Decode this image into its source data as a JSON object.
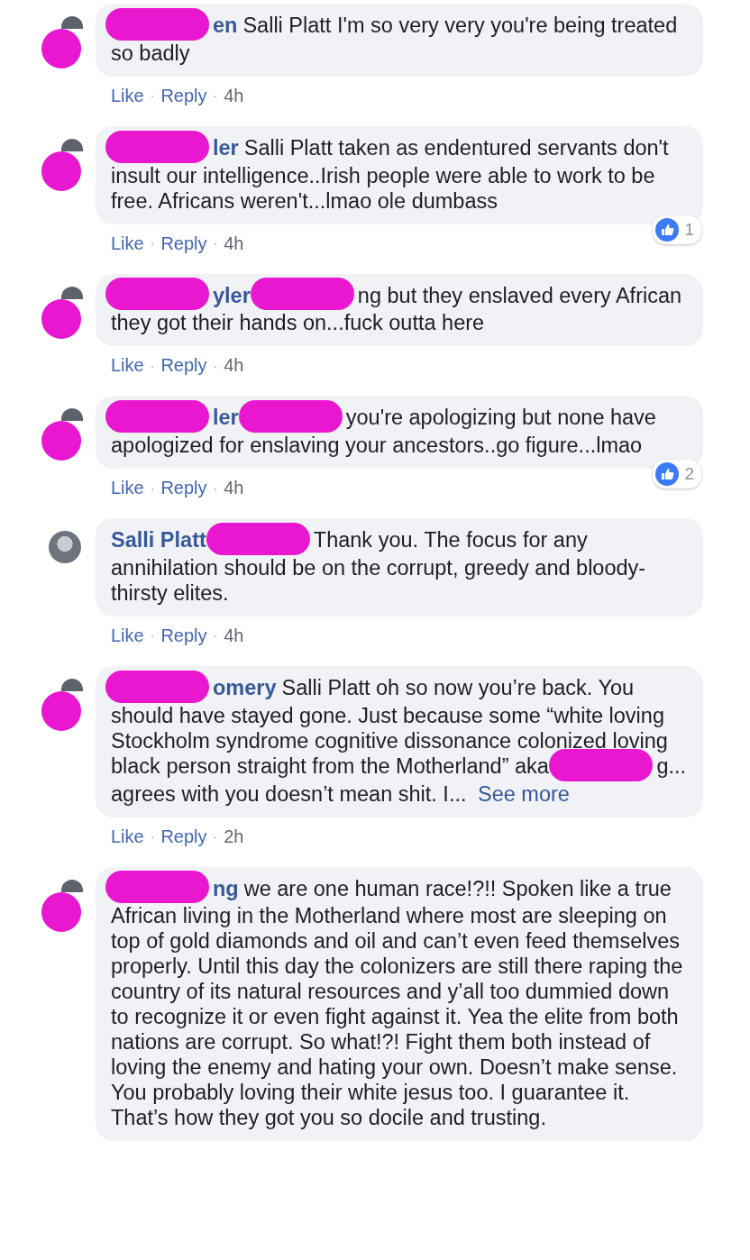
{
  "comments": [
    {
      "avatar_redacted": true,
      "segments": [
        {
          "kind": "redaction"
        },
        {
          "kind": "name",
          "text": "en"
        },
        {
          "kind": "text",
          "text": "Salli Platt I'm so very very you're being treated so badly"
        }
      ],
      "actions": [
        {
          "kind": "link",
          "text": "Like"
        },
        {
          "kind": "sep",
          "text": "·"
        },
        {
          "kind": "link",
          "text": "Reply"
        },
        {
          "kind": "sep",
          "text": "·"
        },
        {
          "kind": "time",
          "text": "4h"
        }
      ]
    },
    {
      "avatar_redacted": true,
      "segments": [
        {
          "kind": "redaction"
        },
        {
          "kind": "name",
          "text": "ler"
        },
        {
          "kind": "text",
          "text": "Salli Platt taken as endentured servants don't insult our intelligence..Irish people were able to work to be free. Africans weren't...lmao ole dumbass"
        }
      ],
      "reactions": "1",
      "actions": [
        {
          "kind": "link",
          "text": "Like"
        },
        {
          "kind": "sep",
          "text": "·"
        },
        {
          "kind": "link",
          "text": "Reply"
        },
        {
          "kind": "sep",
          "text": "·"
        },
        {
          "kind": "time",
          "text": "4h"
        }
      ]
    },
    {
      "avatar_redacted": true,
      "segments": [
        {
          "kind": "redaction"
        },
        {
          "kind": "name",
          "text": "yler"
        },
        {
          "kind": "redaction"
        },
        {
          "kind": "text",
          "text": "ng but they enslaved every African they got their hands on...fuck outta here"
        }
      ],
      "actions": [
        {
          "kind": "link",
          "text": "Like"
        },
        {
          "kind": "sep",
          "text": "·"
        },
        {
          "kind": "link",
          "text": "Reply"
        },
        {
          "kind": "sep",
          "text": "·"
        },
        {
          "kind": "time",
          "text": "4h"
        }
      ]
    },
    {
      "avatar_redacted": true,
      "segments": [
        {
          "kind": "redaction"
        },
        {
          "kind": "name",
          "text": "ler"
        },
        {
          "kind": "redaction"
        },
        {
          "kind": "text",
          "text": "you're apologizing but none have apologized for enslaving your ancestors..go figure...lmao"
        }
      ],
      "reactions": "2",
      "actions": [
        {
          "kind": "link",
          "text": "Like"
        },
        {
          "kind": "sep",
          "text": "·"
        },
        {
          "kind": "link",
          "text": "Reply"
        },
        {
          "kind": "sep",
          "text": "·"
        },
        {
          "kind": "time",
          "text": "4h"
        }
      ]
    },
    {
      "avatar_redacted": false,
      "segments": [
        {
          "kind": "name",
          "text": "Salli Platt"
        },
        {
          "kind": "redaction"
        },
        {
          "kind": "text",
          "text": "Thank you. The focus for any annihilation should be on the corrupt, greedy and bloody-thirsty elites."
        }
      ],
      "actions": [
        {
          "kind": "link",
          "text": "Like"
        },
        {
          "kind": "sep",
          "text": "·"
        },
        {
          "kind": "link",
          "text": "Reply"
        },
        {
          "kind": "sep",
          "text": "·"
        },
        {
          "kind": "time",
          "text": "4h"
        }
      ]
    },
    {
      "avatar_redacted": true,
      "segments": [
        {
          "kind": "redaction"
        },
        {
          "kind": "name",
          "text": "omery"
        },
        {
          "kind": "text",
          "text": "Salli Platt oh so now you’re back. You should have stayed gone. Just because some “white loving Stockholm syndrome cognitive dissonance colonized loving black person straight from the Motherland” aka"
        },
        {
          "kind": "redaction"
        },
        {
          "kind": "text",
          "text": "g... agrees with you doesn’t mean shit. I..."
        },
        {
          "kind": "link",
          "text": "See more"
        }
      ],
      "actions": [
        {
          "kind": "link",
          "text": "Like"
        },
        {
          "kind": "sep",
          "text": "·"
        },
        {
          "kind": "link",
          "text": "Reply"
        },
        {
          "kind": "sep",
          "text": "·"
        },
        {
          "kind": "time",
          "text": "2h"
        }
      ]
    },
    {
      "avatar_redacted": true,
      "segments": [
        {
          "kind": "redaction"
        },
        {
          "kind": "name",
          "text": "ng"
        },
        {
          "kind": "text",
          "text": "we are one human race!?!! Spoken like a true African living in the Motherland where most are sleeping on top of gold diamonds and oil and can’t even feed themselves properly. Until this day the colonizers are still there raping the country of its natural resources and y’all too dummied down to recognize it or even fight against it. Yea the elite from both nations are corrupt. So what!?! Fight them both instead of loving the enemy and hating your own. Doesn’t make sense. You probably loving their white jesus too. I guarantee it. That’s how they got you so docile and trusting."
        }
      ]
    }
  ]
}
